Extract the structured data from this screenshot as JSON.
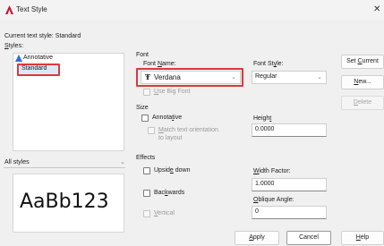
{
  "window": {
    "title": "Text Style",
    "close_glyph": "✕"
  },
  "current_style": "Current text style:  Standard",
  "styles": {
    "label": "Styles:",
    "items": [
      "Annotative",
      "Standard"
    ],
    "selected": "Standard"
  },
  "filter": {
    "value": "All styles"
  },
  "preview": {
    "sample": "AaBb123"
  },
  "font": {
    "group_label": "Font",
    "name_label": "Font Name:",
    "name_value": "Verdana",
    "style_label": "Font Style:",
    "style_value": "Regular",
    "big_font_label": "Use Big Font"
  },
  "size": {
    "group_label": "Size",
    "annotative_label": "Annotative",
    "match_label_1": "Match text orientation",
    "match_label_2": "to layout",
    "height_label": "Height",
    "height_value": "0.0000"
  },
  "effects": {
    "group_label": "Effects",
    "upside_down_label": "Upside down",
    "backwards_label": "Backwards",
    "vertical_label": "Vertical",
    "width_factor_label": "Width Factor:",
    "width_factor_value": "1.0000",
    "oblique_label": "Oblique Angle:",
    "oblique_value": "0"
  },
  "buttons": {
    "set_current": "Set Current",
    "new": "New...",
    "delete": "Delete",
    "apply": "Apply",
    "cancel": "Cancel",
    "help": "Help"
  },
  "colors": {
    "highlight": "#e0373c",
    "accent": "#c8102e"
  }
}
